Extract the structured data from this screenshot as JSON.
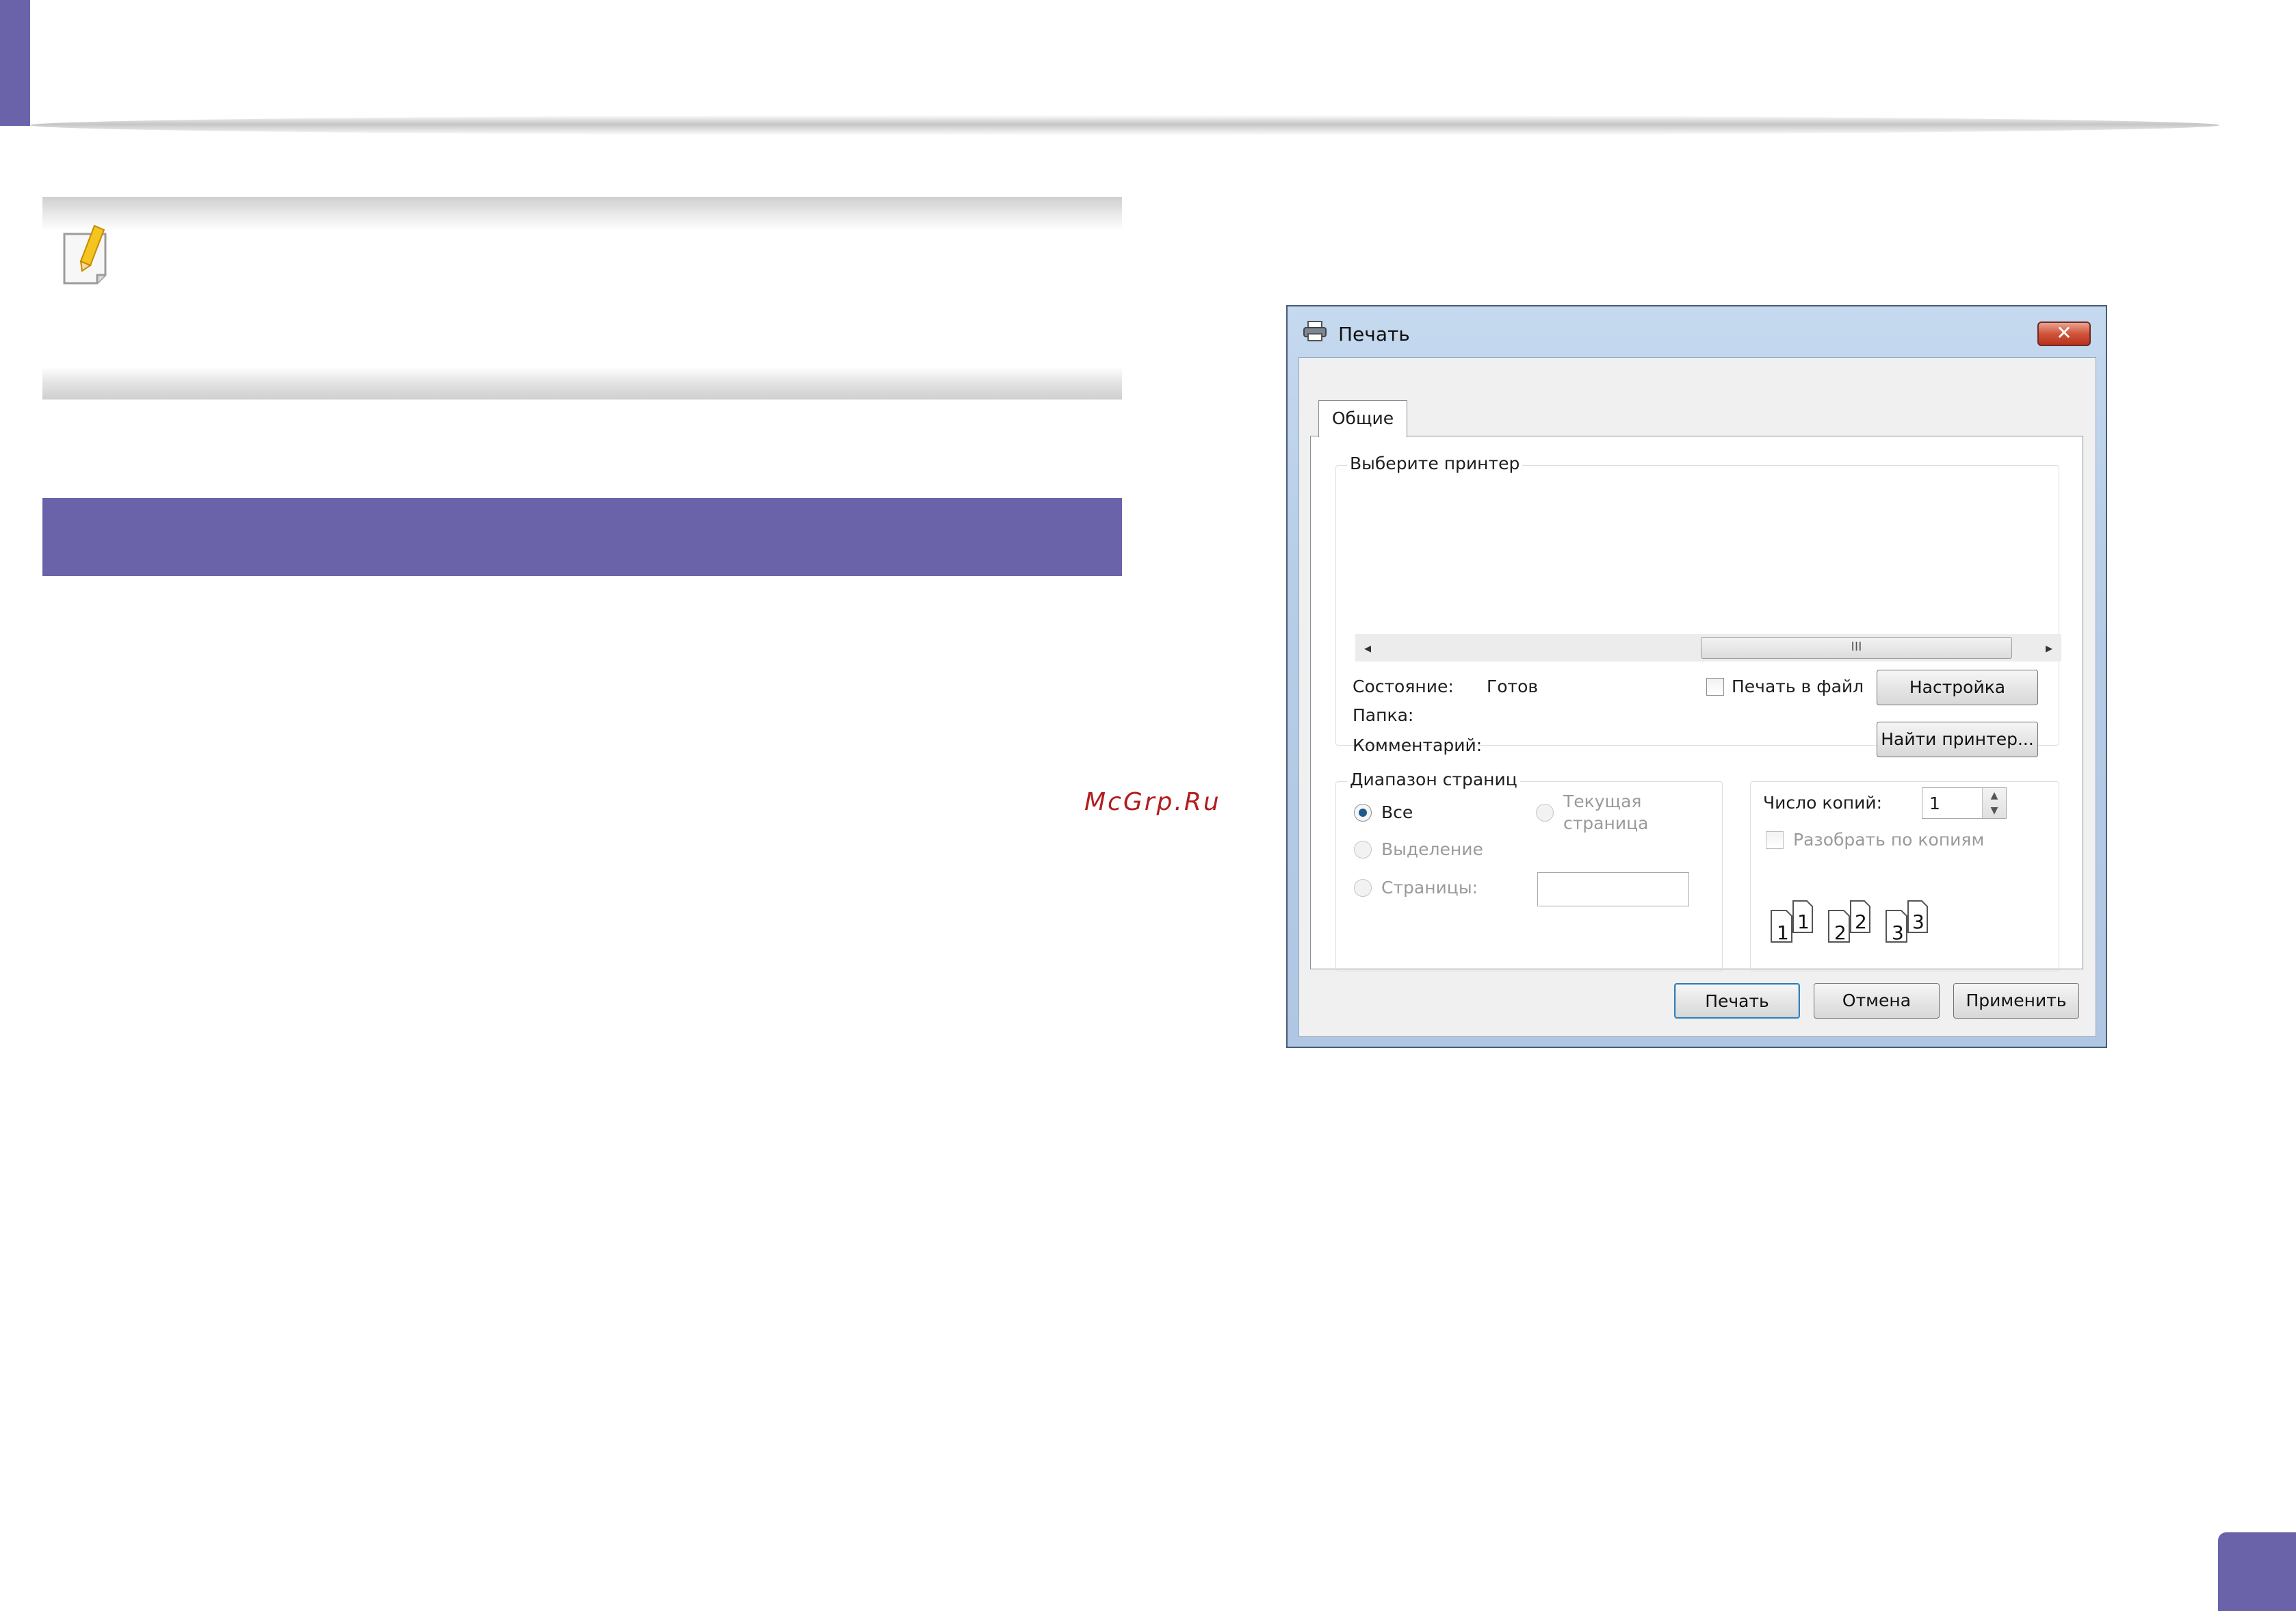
{
  "colors": {
    "accent": "#6b63aa",
    "watermark": "#b21d1d"
  },
  "watermark": "McGrp.Ru",
  "note_icon": "note-pencil-icon",
  "dialog": {
    "title": "Печать",
    "title_icon": "printer-icon",
    "close_icon": "close-icon",
    "close_label": "✕",
    "tab": "Общие",
    "select_printer": {
      "title": "Выберите принтер",
      "scroll_left": "◂",
      "scroll_right": "▸",
      "scroll_grip": "III"
    },
    "status_label": "Состояние:",
    "status_value": "Готов",
    "location_label": "Папка:",
    "comment_label": "Комментарий:",
    "print_to_file": "Печать в файл",
    "preferences_button": "Настройка",
    "find_printer_button": "Найти принтер...",
    "page_range": {
      "title": "Диапазон страниц",
      "all": "Все",
      "selection": "Выделение",
      "current_page_line1": "Текущая",
      "current_page_line2": "страница",
      "pages": "Страницы:",
      "pages_value": ""
    },
    "copies": {
      "label": "Число копий:",
      "value": "1",
      "collate": "Разобрать по копиям",
      "collate_icon": "collate-pages-icon"
    },
    "buttons": {
      "print": "Печать",
      "cancel": "Отмена",
      "apply": "Применить"
    }
  }
}
